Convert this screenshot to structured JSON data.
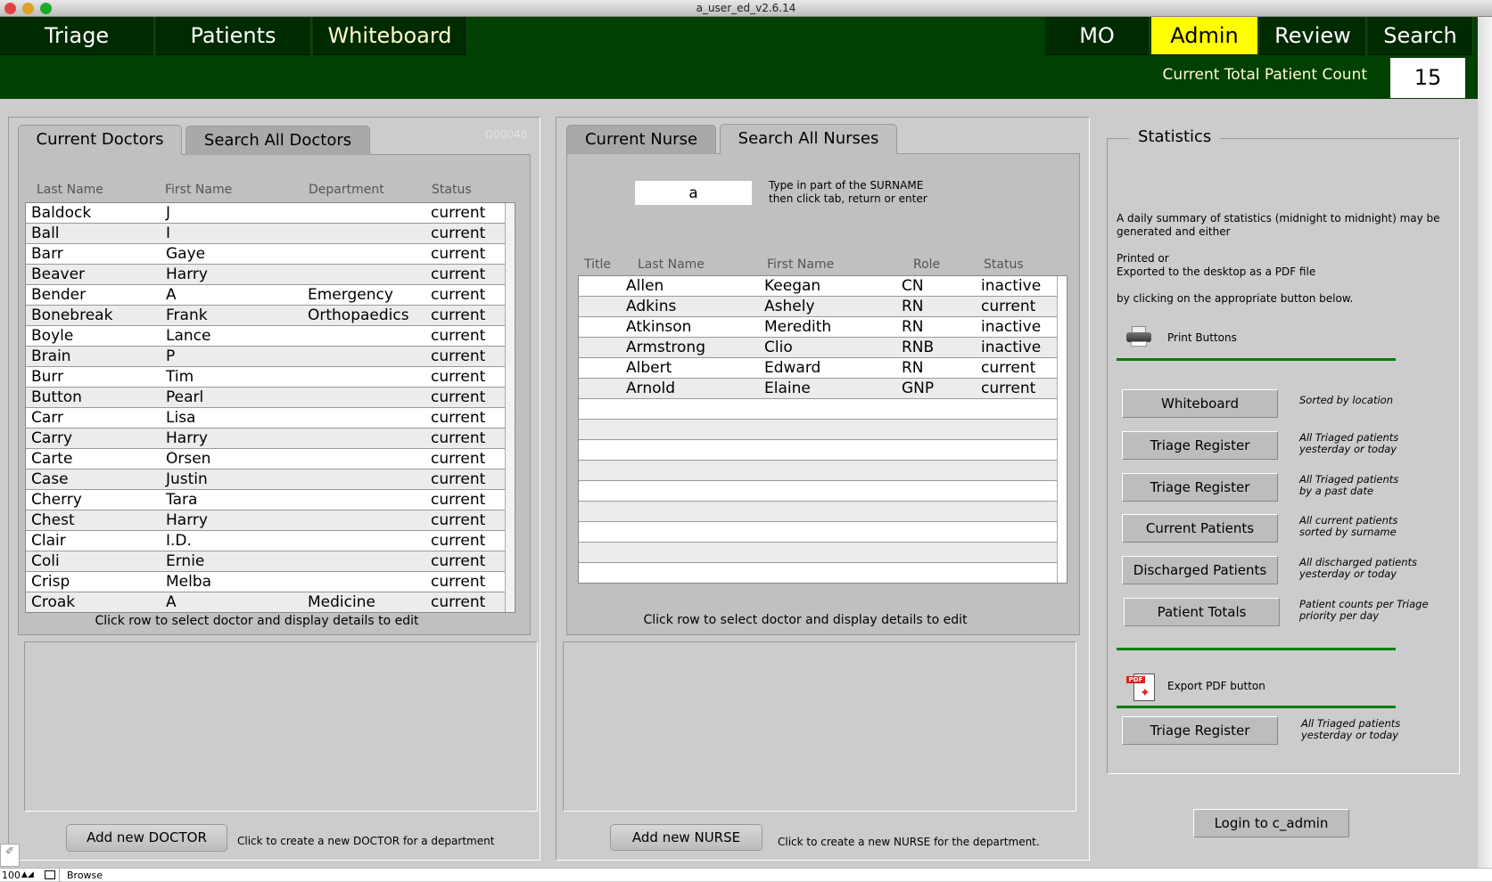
{
  "window": {
    "title": "a_user_ed_v2.6.14"
  },
  "nav": {
    "left": [
      "Triage",
      "Patients",
      "Whiteboard"
    ],
    "right": [
      "MO",
      "Admin",
      "Review",
      "Search"
    ],
    "active": "Admin",
    "active_color": "#ffff00",
    "bar_color": "#004000"
  },
  "count": {
    "label": "Current Total Patient Count",
    "value": "15"
  },
  "doctors": {
    "tabs": [
      "Current Doctors",
      "Search All Doctors"
    ],
    "active_tab": "Current Doctors",
    "record_id": "D00048",
    "columns": [
      "Last Name",
      "First  Name",
      "Department",
      "Status"
    ],
    "rows": [
      [
        "Baldock",
        "J",
        "",
        "current"
      ],
      [
        "Ball",
        "I",
        "",
        "current"
      ],
      [
        "Barr",
        "Gaye",
        "",
        "current"
      ],
      [
        "Beaver",
        "Harry",
        "",
        "current"
      ],
      [
        "Bender",
        "A",
        "Emergency",
        "current"
      ],
      [
        "Bonebreak",
        "Frank",
        "Orthopaedics",
        "current"
      ],
      [
        "Boyle",
        "Lance",
        "",
        "current"
      ],
      [
        "Brain",
        "P",
        "",
        "current"
      ],
      [
        "Burr",
        "Tim",
        "",
        "current"
      ],
      [
        "Button",
        "Pearl",
        "",
        "current"
      ],
      [
        "Carr",
        "Lisa",
        "",
        "current"
      ],
      [
        "Carry",
        "Harry",
        "",
        "current"
      ],
      [
        "Carte",
        "Orsen",
        "",
        "current"
      ],
      [
        "Case",
        "Justin",
        "",
        "current"
      ],
      [
        "Cherry",
        "Tara",
        "",
        "current"
      ],
      [
        "Chest",
        "Harry",
        "",
        "current"
      ],
      [
        "Clair",
        "I.D.",
        "",
        "current"
      ],
      [
        "Coli",
        "Ernie",
        "",
        "current"
      ],
      [
        "Crisp",
        "Melba",
        "",
        "current"
      ],
      [
        "Croak",
        "A",
        "Medicine",
        "current"
      ]
    ],
    "caption": "Click row to select doctor and display details to edit",
    "add_button": "Add new DOCTOR",
    "add_hint": "Click to create a new DOCTOR for a department"
  },
  "nurses": {
    "tabs": [
      "Current Nurse",
      "Search All Nurses"
    ],
    "active_tab": "Search All Nurses",
    "search_value": "a",
    "search_hint": [
      "Type in part of the SURNAME",
      "then click tab, return or enter"
    ],
    "columns": [
      "Title",
      "Last Name",
      "First  Name",
      "Role",
      "Status"
    ],
    "rows": [
      [
        "",
        "Allen",
        "Keegan",
        "CN",
        "inactive"
      ],
      [
        "",
        "Adkins",
        "Ashely",
        "RN",
        "current"
      ],
      [
        "",
        "Atkinson",
        "Meredith",
        "RN",
        "inactive"
      ],
      [
        "",
        "Armstrong",
        "Clio",
        "RNB",
        "inactive"
      ],
      [
        "",
        "Albert",
        "Edward",
        "RN",
        "current"
      ],
      [
        "",
        "Arnold",
        "Elaine",
        "GNP",
        "current"
      ]
    ],
    "caption": "Click row to select doctor and display details to edit",
    "add_button": "Add new NURSE",
    "add_hint": "Click to create a new NURSE for the department."
  },
  "statistics": {
    "legend": "Statistics",
    "intro": [
      "A daily summary of statistics (midnight to midnight) may be",
      "generated and either",
      "Printed or",
      "Exported to the desktop as a PDF file",
      "by clicking on the appropriate button below."
    ],
    "print_label": "Print Buttons",
    "print_buttons": [
      {
        "label": "Whiteboard",
        "desc": [
          "Sorted by location"
        ]
      },
      {
        "label": "Triage Register",
        "desc": [
          "All Triaged patients",
          "yesterday or today"
        ]
      },
      {
        "label": "Triage Register",
        "desc": [
          "All Triaged patients",
          "by a past date"
        ]
      },
      {
        "label": "Current Patients",
        "desc": [
          "All current patients",
          "sorted by surname"
        ]
      },
      {
        "label": "Discharged Patients",
        "desc": [
          "All discharged patients",
          "yesterday or today"
        ]
      },
      {
        "label": "Patient Totals",
        "desc": [
          "Patient counts per Triage",
          "priority per day"
        ]
      }
    ],
    "export_label": "Export PDF button",
    "export_icon_text": "PDF",
    "export_buttons": [
      {
        "label": "Triage Register",
        "desc": [
          "All Triaged patients",
          "yesterday or today"
        ]
      }
    ]
  },
  "login_button": "Login to c_admin",
  "statusbar": {
    "zoom": "100",
    "mode": "Browse"
  }
}
